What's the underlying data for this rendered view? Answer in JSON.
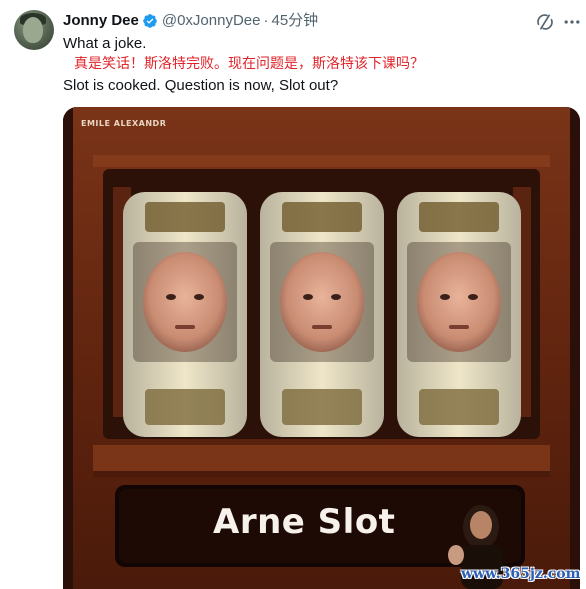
{
  "tweet": {
    "author_name": "Jonny Dee",
    "author_handle": "@0xJonnyDee",
    "separator": "·",
    "timestamp": "45分钟",
    "text_line_1": "What a joke.",
    "text_line_2": "真是笑话！斯洛特完败。现在问题是，斯洛特该下课吗？",
    "text_line_3": "Slot is cooked. Question is now, Slot out?"
  },
  "media": {
    "corner_label": "EMILE ALEXANDR",
    "caption": "Arne Slot",
    "reel_symbol": "face",
    "reels": [
      "reel-left",
      "reel-middle",
      "reel-right"
    ]
  },
  "watermark": {
    "site": "www.365jz.com"
  },
  "colors": {
    "verified": "#1d9bf0",
    "translation_text": "#e0242a",
    "secondary_text": "#536471",
    "slot_wood": "#6e2a12",
    "watermark": "#2b5fb5"
  },
  "icons": [
    "verified-badge-icon",
    "grok-icon",
    "more-icon"
  ]
}
